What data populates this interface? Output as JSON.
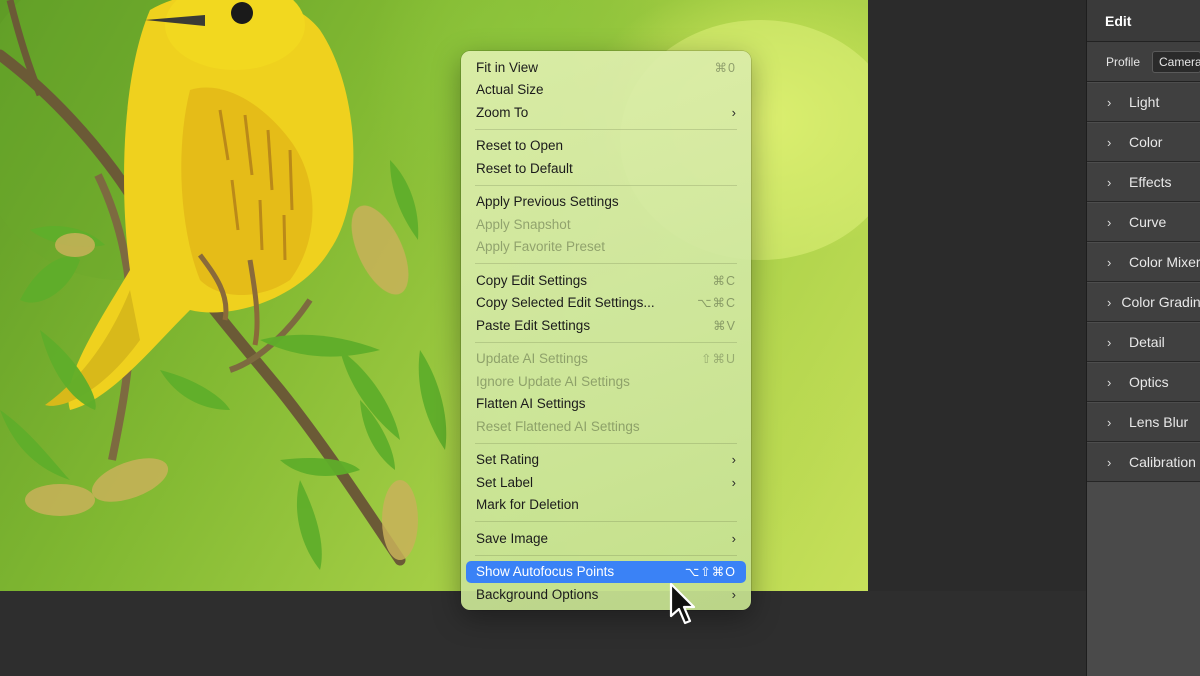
{
  "context_menu": {
    "groups": [
      [
        {
          "label": "Fit in View",
          "shortcut": "⌘0",
          "submenu": false,
          "disabled": false
        },
        {
          "label": "Actual Size",
          "shortcut": "",
          "submenu": false,
          "disabled": false
        },
        {
          "label": "Zoom To",
          "shortcut": "",
          "submenu": true,
          "disabled": false
        }
      ],
      [
        {
          "label": "Reset to Open",
          "shortcut": "",
          "submenu": false,
          "disabled": false
        },
        {
          "label": "Reset to Default",
          "shortcut": "",
          "submenu": false,
          "disabled": false
        }
      ],
      [
        {
          "label": "Apply Previous Settings",
          "shortcut": "",
          "submenu": false,
          "disabled": false
        },
        {
          "label": "Apply Snapshot",
          "shortcut": "",
          "submenu": false,
          "disabled": true
        },
        {
          "label": "Apply Favorite Preset",
          "shortcut": "",
          "submenu": false,
          "disabled": true
        }
      ],
      [
        {
          "label": "Copy Edit Settings",
          "shortcut": "⌘C",
          "submenu": false,
          "disabled": false
        },
        {
          "label": "Copy Selected Edit Settings...",
          "shortcut": "⌥⌘C",
          "submenu": false,
          "disabled": false
        },
        {
          "label": "Paste Edit Settings",
          "shortcut": "⌘V",
          "submenu": false,
          "disabled": false
        }
      ],
      [
        {
          "label": "Update AI Settings",
          "shortcut": "⇧⌘U",
          "submenu": false,
          "disabled": true
        },
        {
          "label": "Ignore Update AI Settings",
          "shortcut": "",
          "submenu": false,
          "disabled": true
        },
        {
          "label": "Flatten AI Settings",
          "shortcut": "",
          "submenu": false,
          "disabled": false
        },
        {
          "label": "Reset Flattened AI Settings",
          "shortcut": "",
          "submenu": false,
          "disabled": true
        }
      ],
      [
        {
          "label": "Set Rating",
          "shortcut": "",
          "submenu": true,
          "disabled": false
        },
        {
          "label": "Set Label",
          "shortcut": "",
          "submenu": true,
          "disabled": false
        },
        {
          "label": "Mark for Deletion",
          "shortcut": "",
          "submenu": false,
          "disabled": false
        }
      ],
      [
        {
          "label": "Save Image",
          "shortcut": "",
          "submenu": true,
          "disabled": false
        }
      ],
      [
        {
          "label": "Show Autofocus Points",
          "shortcut": "⌥⇧⌘O",
          "submenu": false,
          "disabled": false,
          "highlighted": true
        },
        {
          "label": "Background Options",
          "shortcut": "",
          "submenu": true,
          "disabled": false
        }
      ]
    ],
    "submenu_glyph": "›"
  },
  "edit_panel": {
    "title": "Edit",
    "profile_label": "Profile",
    "profile_value": "Camera",
    "sections": [
      "Light",
      "Color",
      "Effects",
      "Curve",
      "Color Mixer",
      "Color Grading",
      "Detail",
      "Optics",
      "Lens Blur",
      "Calibration"
    ],
    "chevron_glyph": "›"
  },
  "colors": {
    "highlight": "#3a82f6",
    "panel_bg": "#404040"
  },
  "icons": {
    "section_chevron": "chevron-right-icon",
    "submenu_arrow": "chevron-right-icon",
    "cursor": "pointer-cursor-icon"
  }
}
